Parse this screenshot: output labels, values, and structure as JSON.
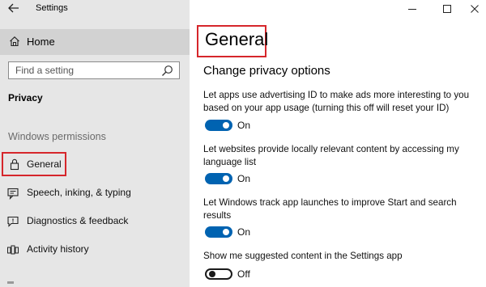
{
  "window": {
    "title": "Settings"
  },
  "sidebar": {
    "home_label": "Home",
    "search_placeholder": "Find a setting",
    "section_title": "Privacy",
    "group_title": "Windows permissions",
    "items": [
      {
        "label": "General",
        "icon": "lock-icon"
      },
      {
        "label": "Speech, inking, & typing",
        "icon": "speech-icon"
      },
      {
        "label": "Diagnostics & feedback",
        "icon": "feedback-icon"
      },
      {
        "label": "Activity history",
        "icon": "activity-icon"
      }
    ]
  },
  "main": {
    "title": "General",
    "subheading": "Change privacy options",
    "options": [
      {
        "text": "Let apps use advertising ID to make ads more interesting to you based on your app usage (turning this off will reset your ID)",
        "state": "On"
      },
      {
        "text": "Let websites provide locally relevant content by accessing my language list",
        "state": "On"
      },
      {
        "text": "Let Windows track app launches to improve Start and search results",
        "state": "On"
      },
      {
        "text": "Show me suggested content in the Settings app",
        "state": "Off"
      }
    ]
  },
  "colors": {
    "accent": "#0063b1",
    "highlight": "#d6262b",
    "sidebar_bg": "#e6e6e6"
  }
}
